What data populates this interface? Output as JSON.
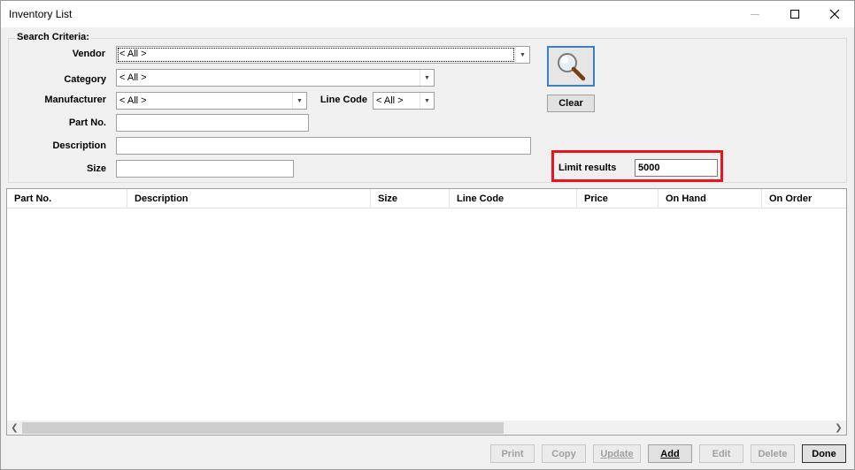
{
  "window": {
    "title": "Inventory List"
  },
  "search_criteria": {
    "legend": "Search Criteria:",
    "vendor": {
      "label": "Vendor",
      "value": "< All >"
    },
    "category": {
      "label": "Category",
      "value": "< All >"
    },
    "manufacturer": {
      "label": "Manufacturer",
      "value": "< All >"
    },
    "line_code": {
      "label": "Line Code",
      "value": "< All >"
    },
    "part_no": {
      "label": "Part No.",
      "value": ""
    },
    "description": {
      "label": "Description",
      "value": ""
    },
    "size": {
      "label": "Size",
      "value": ""
    },
    "search_icon": "magnifier-icon",
    "clear_label": "Clear",
    "limit": {
      "label": "Limit results",
      "value": "5000"
    }
  },
  "grid": {
    "columns": [
      "Part No.",
      "Description",
      "Size",
      "Line Code",
      "Price",
      "On Hand",
      "On Order"
    ],
    "rows": []
  },
  "footer": {
    "print": "Print",
    "copy": "Copy",
    "update": "Update",
    "add": "Add",
    "edit": "Edit",
    "delete": "Delete",
    "done": "Done"
  },
  "colors": {
    "highlight": "#e8141e",
    "focus_border": "#3a7fc8"
  }
}
